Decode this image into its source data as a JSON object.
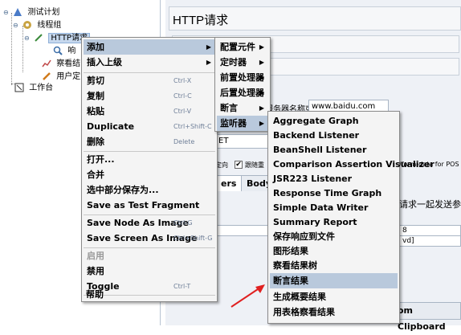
{
  "tree": {
    "nodes": [
      {
        "label": "测试计划",
        "icon": "test-plan-icon"
      },
      {
        "label": "线程组",
        "icon": "gear-icon"
      },
      {
        "label": "HTTP请求",
        "icon": "pencil-icon",
        "selected": true
      },
      {
        "label": "响",
        "icon": "magnifier-icon"
      },
      {
        "label": "察看结",
        "icon": "chart-icon"
      },
      {
        "label": "用户定",
        "icon": "wrench-icon"
      },
      {
        "label": "工作台",
        "icon": "workbench-icon"
      }
    ]
  },
  "panel": {
    "title": "HTTP请求",
    "server_label": "服务器名称或IP:",
    "server_value": "www.baidu.com",
    "method_fragment": "ET",
    "redirect_fragment": "定向",
    "keepalive_fragment": "跟随重",
    "multipart_fragment": "/form-data for POS",
    "tab_params": "ers",
    "tab_body": "Body D",
    "send_params_fragment": "请求一起发送参数",
    "value_1": "8",
    "value_2": "vd]",
    "clipboard_button": "om Clipboard"
  },
  "context_menu": {
    "items": [
      {
        "label": "添加",
        "arrow": true,
        "highlighted": true
      },
      {
        "label": "插入上级",
        "arrow": true
      },
      {
        "sep": true
      },
      {
        "label": "剪切",
        "shortcut": "Ctrl-X"
      },
      {
        "label": "复制",
        "shortcut": "Ctrl-C"
      },
      {
        "label": "粘贴",
        "shortcut": "Ctrl-V"
      },
      {
        "label": "Duplicate",
        "shortcut": "Ctrl+Shift-C"
      },
      {
        "label": "删除",
        "shortcut": "Delete"
      },
      {
        "sep": true
      },
      {
        "label": "打开..."
      },
      {
        "label": "合并"
      },
      {
        "label": "选中部分保存为..."
      },
      {
        "label": "Save as Test Fragment"
      },
      {
        "sep": true
      },
      {
        "label": "Save Node As Image",
        "shortcut": "Ctrl-G"
      },
      {
        "label": "Save Screen As Image",
        "shortcut": "Ctrl+Shift-G"
      },
      {
        "sep": true
      },
      {
        "label": "启用",
        "disabled": true
      },
      {
        "label": "禁用"
      },
      {
        "label": "Toggle",
        "shortcut": "Ctrl-T"
      },
      {
        "sep": true
      },
      {
        "label": "帮助"
      }
    ]
  },
  "add_submenu": {
    "items": [
      {
        "label": "配置元件",
        "arrow": true
      },
      {
        "label": "定时器",
        "arrow": true
      },
      {
        "label": "前置处理器",
        "arrow": true
      },
      {
        "label": "后置处理器",
        "arrow": true
      },
      {
        "label": "断言",
        "arrow": true
      },
      {
        "label": "监听器",
        "arrow": true,
        "highlighted": true
      }
    ]
  },
  "listener_submenu": {
    "items": [
      {
        "label": "Aggregate Graph"
      },
      {
        "label": "Backend Listener"
      },
      {
        "label": "BeanShell Listener"
      },
      {
        "label": "Comparison Assertion Visualizer"
      },
      {
        "label": "JSR223 Listener"
      },
      {
        "label": "Response Time Graph"
      },
      {
        "label": "Simple Data Writer"
      },
      {
        "label": "Summary Report"
      },
      {
        "label": "保存响应到文件"
      },
      {
        "label": "图形结果"
      },
      {
        "label": "察看结果树"
      },
      {
        "label": "断言结果",
        "highlighted": true
      },
      {
        "label": "生成概要结果"
      },
      {
        "label": "用表格察看结果"
      }
    ]
  },
  "colors": {
    "menu_bg": "#f4f4f4",
    "highlight": "#b9c9dc",
    "arrow_annotation": "#e02020"
  }
}
